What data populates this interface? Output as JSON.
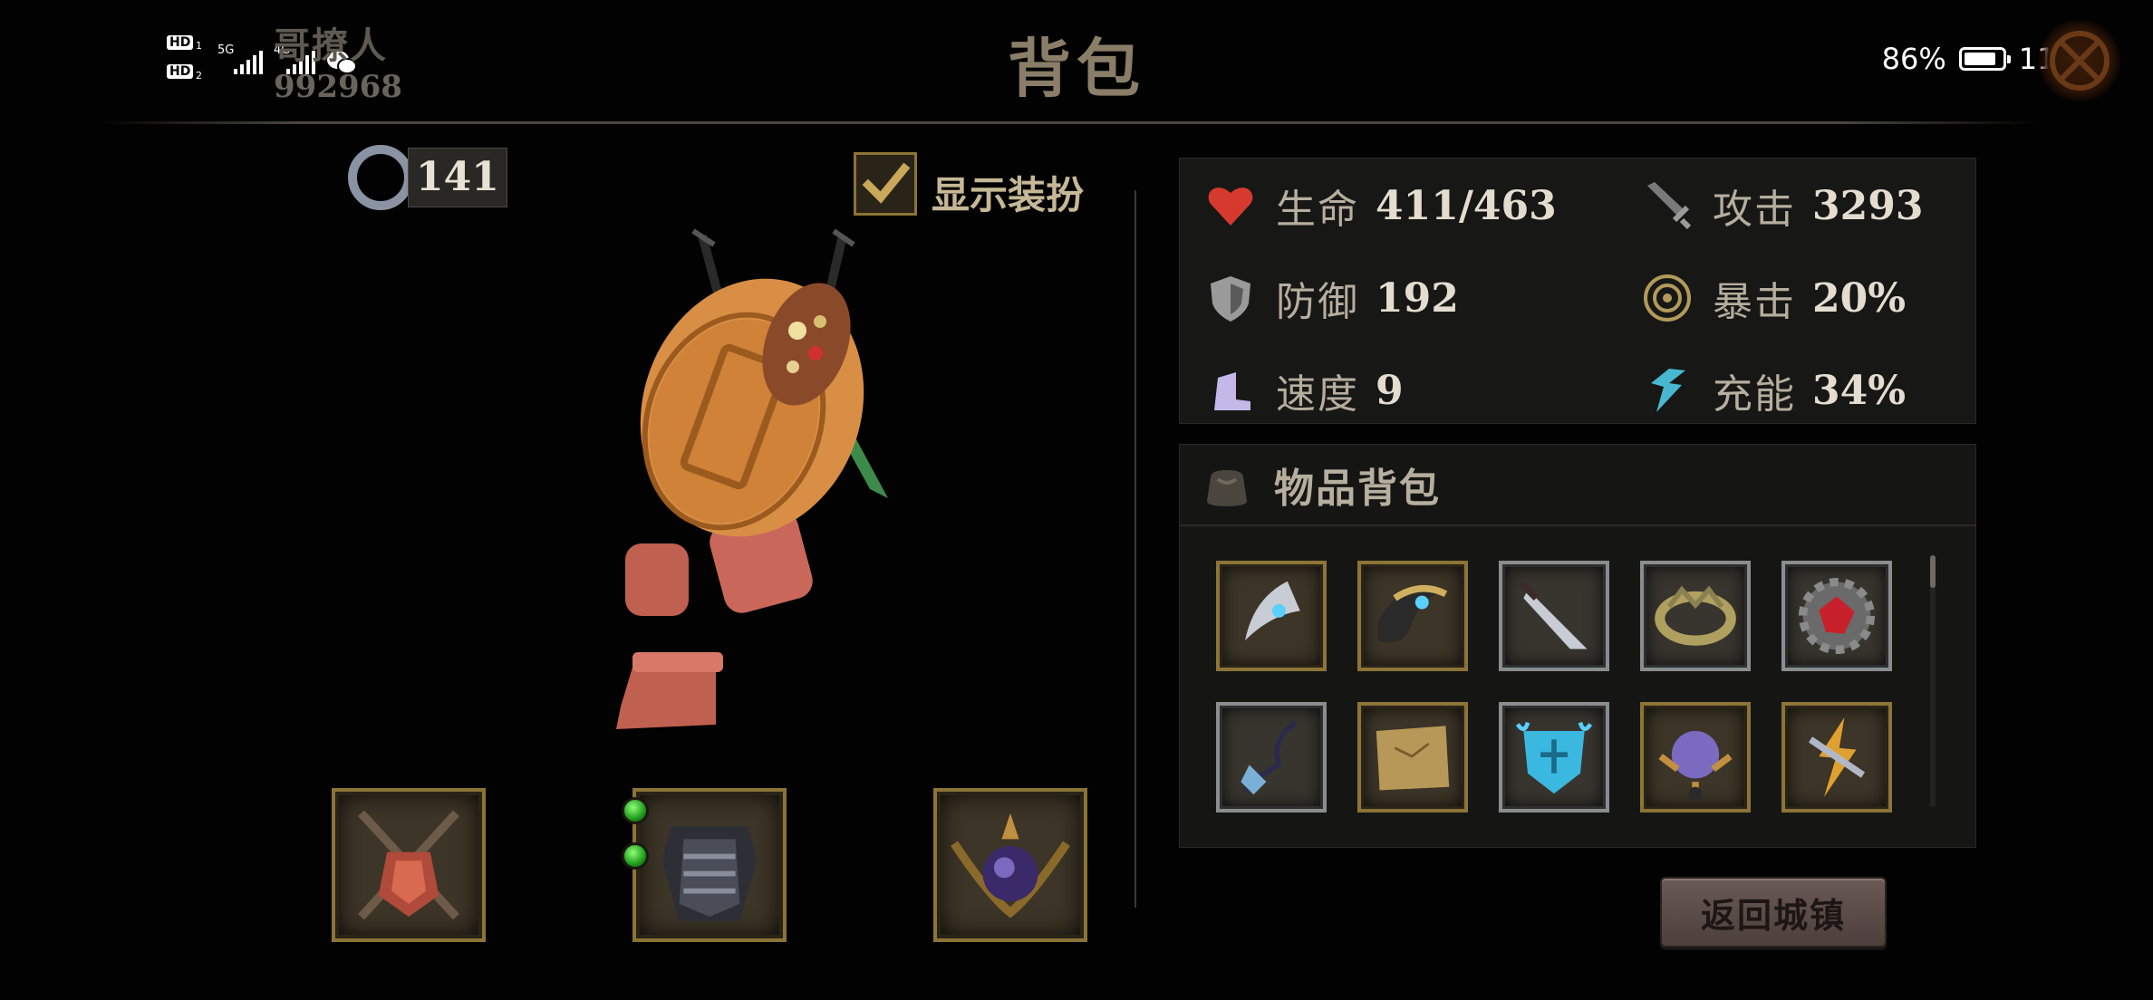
{
  "status_bar": {
    "sim1": "HD",
    "sim1_num": "1",
    "sim2": "HD",
    "sim2_num": "2",
    "net1": "5G",
    "net2": "4G",
    "battery": "86%",
    "battery_level": 0.86,
    "time": "11:41"
  },
  "player": {
    "name": "哥撩人",
    "id": "992968"
  },
  "page_title": "背包",
  "currency": {
    "icon": "ring-icon",
    "value": "141"
  },
  "show_outfit": {
    "label": "显示装扮",
    "checked": true
  },
  "stats": [
    {
      "icon": "heart-icon",
      "label": "生命",
      "value": "411/463",
      "color": "#d63a2e"
    },
    {
      "icon": "sword-icon",
      "label": "攻击",
      "value": "3293",
      "color": "#8f8f8f"
    },
    {
      "icon": "shield-icon",
      "label": "防御",
      "value": "192",
      "color": "#9a9a9a"
    },
    {
      "icon": "crit-icon",
      "label": "暴击",
      "value": "20%",
      "color": "#b29a5a"
    },
    {
      "icon": "boot-icon",
      "label": "速度",
      "value": "9",
      "color": "#c3b8e8"
    },
    {
      "icon": "energy-icon",
      "label": "充能",
      "value": "34%",
      "color": "#48b8d0"
    }
  ],
  "bag": {
    "title": "物品背包",
    "icon": "bag-icon",
    "items": [
      {
        "name": "crescent-blade-icon",
        "frame": "gold"
      },
      {
        "name": "horn-bracer-icon",
        "frame": "gold"
      },
      {
        "name": "dagger-icon",
        "frame": "silver"
      },
      {
        "name": "ring-crown-icon",
        "frame": "silver"
      },
      {
        "name": "ruby-gear-icon",
        "frame": "silver"
      },
      {
        "name": "chain-amulet-icon",
        "frame": "silver"
      },
      {
        "name": "map-scroll-icon",
        "frame": "gold"
      },
      {
        "name": "ice-shield-icon",
        "frame": "silver"
      },
      {
        "name": "orb-helm-icon",
        "frame": "gold"
      },
      {
        "name": "lightning-shard-icon",
        "frame": "gold"
      }
    ]
  },
  "equipment": [
    {
      "name": "crossed-swords-armor-icon"
    },
    {
      "name": "chest-armor-icon",
      "gems": 2
    },
    {
      "name": "orb-relic-icon"
    }
  ],
  "back_button": "返回城镇"
}
